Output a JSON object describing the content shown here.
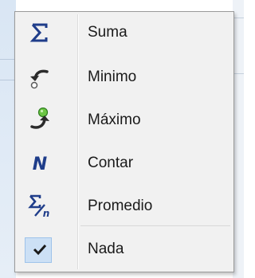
{
  "menu": {
    "items": [
      {
        "label": "Suma",
        "icon": "sigma-icon"
      },
      {
        "label": "Minimo",
        "icon": "min-arrow-icon"
      },
      {
        "label": "Máximo",
        "icon": "max-arrow-icon"
      },
      {
        "label": "Contar",
        "icon": "count-n-icon"
      },
      {
        "label": "Promedio",
        "icon": "average-icon"
      },
      {
        "label": "Nada",
        "icon": "checkmark-icon",
        "checked": true
      }
    ]
  },
  "colors": {
    "icon_blue": "#1f3d8a",
    "icon_green": "#6cc644",
    "check_highlight": "#cce0f5"
  }
}
